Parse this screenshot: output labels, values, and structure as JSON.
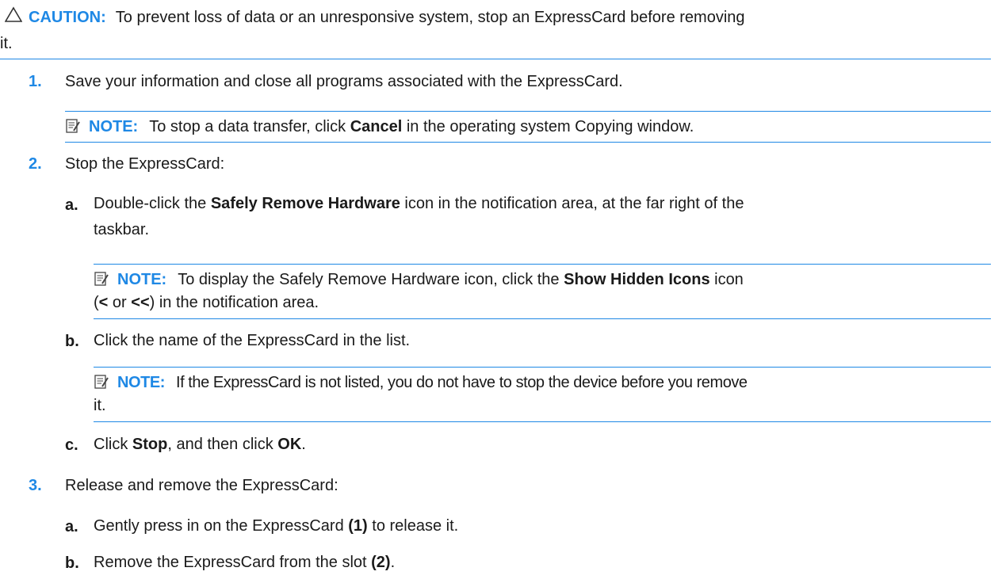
{
  "caution": {
    "label": "CAUTION:",
    "text_line1": "To prevent loss of data or an unresponsive system, stop an ExpressCard before removing",
    "text_line2": "it."
  },
  "steps": [
    {
      "num": "1.",
      "text": "Save your information and close all programs associated with the ExpressCard.",
      "note": {
        "label": "NOTE:",
        "before": "To stop a data transfer, click ",
        "bold": "Cancel",
        "after": " in the operating system Copying window."
      }
    },
    {
      "num": "2.",
      "text": "Stop the ExpressCard:",
      "subs": [
        {
          "letter": "a.",
          "before": "Double-click the ",
          "bold": "Safely Remove Hardware",
          "after_line1": " icon in the notification area, at the far right of the",
          "line2": "taskbar.",
          "note": {
            "label": "NOTE:",
            "before": "To display the Safely Remove Hardware icon, click the ",
            "bold": "Show Hidden Icons",
            "after": " icon",
            "line2_open": "(",
            "line2_b1": "<",
            "line2_or": " or ",
            "line2_b2": "<<",
            "line2_rest": ") in the notification area."
          }
        },
        {
          "letter": "b.",
          "text": "Click the name of the ExpressCard in the list.",
          "note": {
            "label": "NOTE:",
            "text_line1": "If the ExpressCard is not listed, you do not have to stop the device before you remove",
            "text_line2": "it."
          }
        },
        {
          "letter": "c.",
          "before": "Click ",
          "bold1": "Stop",
          "middle": ", and then click ",
          "bold2": "OK",
          "after": "."
        }
      ]
    },
    {
      "num": "3.",
      "text": "Release and remove the ExpressCard:",
      "subs": [
        {
          "letter": "a.",
          "before": "Gently press in on the ExpressCard ",
          "bold": "(1)",
          "after": " to release it."
        },
        {
          "letter": "b.",
          "before": "Remove the ExpressCard from the slot ",
          "bold": "(2)",
          "after": "."
        }
      ]
    }
  ],
  "colors": {
    "accent": "#1e88e5",
    "text": "#1a1a1a"
  },
  "icons": [
    "caution-triangle-icon",
    "note-icon"
  ]
}
